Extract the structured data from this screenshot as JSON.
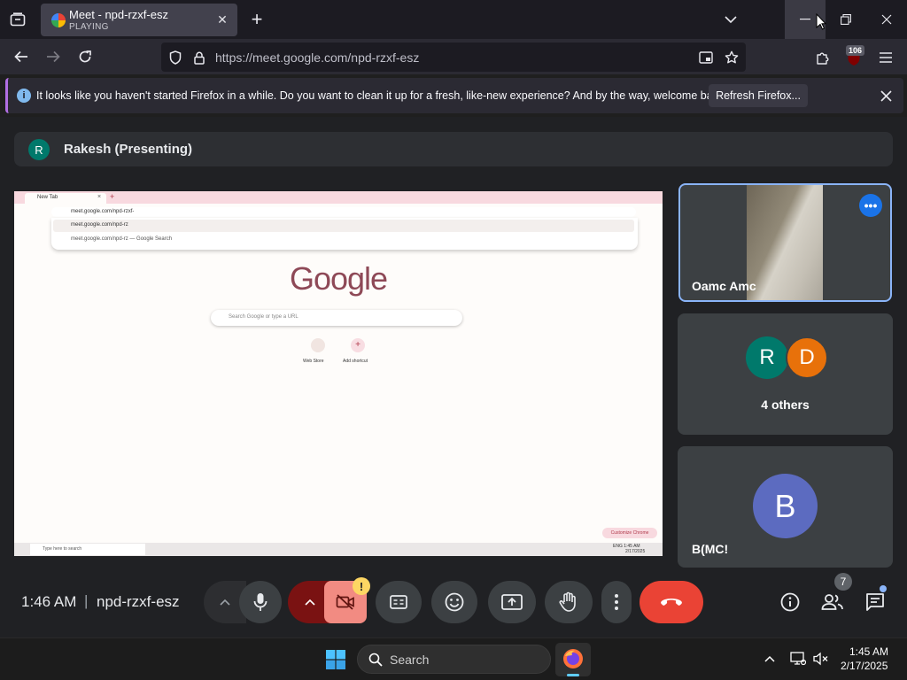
{
  "browser": {
    "tab": {
      "title": "Meet - npd-rzxf-esz",
      "status": "PLAYING"
    },
    "url": "https://meet.google.com/npd-rzxf-esz",
    "notification_badge": "106",
    "notification": {
      "message": "It looks like you haven't started Firefox in a while. Do you want to clean it up for a fresh, like-new experience? And by the way, welcome back!",
      "button": "Refresh Firefox..."
    }
  },
  "meet": {
    "presenter": {
      "initial": "R",
      "label": "Rakesh (Presenting)"
    },
    "shared_screen": {
      "tab_title": "New Tab",
      "address": "meet.google.com/npd-rzxf-",
      "suggestion1": "meet.google.com/npd-rz",
      "suggestion2": "meet.google.com/npd-rz — Google Search",
      "logo": "Google",
      "search_placeholder": "Search Google or type a URL",
      "shortcut1": "Web Store",
      "shortcut2": "Add shortcut",
      "customize": "Customize Chrome",
      "taskbar_search": "Type here to search",
      "time": "ENG 1:45 AM",
      "date": "2/17/2025"
    },
    "tiles": [
      {
        "name": "Oamc Amc"
      },
      {
        "initial1": "R",
        "initial2": "D",
        "label": "4 others"
      },
      {
        "initial": "B",
        "name": "B(MC!"
      }
    ],
    "bottom": {
      "time": "1:46 AM",
      "separator": "|",
      "code": "npd-rzxf-esz",
      "people_count": "7",
      "warning": "!"
    }
  },
  "os_taskbar": {
    "search": "Search",
    "time": "1:45 AM",
    "date": "2/17/2025"
  },
  "colors": {
    "accent_blue": "#8ab4f8",
    "end_call_red": "#ea4335",
    "avatar_R": "#00796b",
    "avatar_D": "#e8710a",
    "avatar_B": "#5c6bc0",
    "notif_accent": "#b16fe3"
  }
}
